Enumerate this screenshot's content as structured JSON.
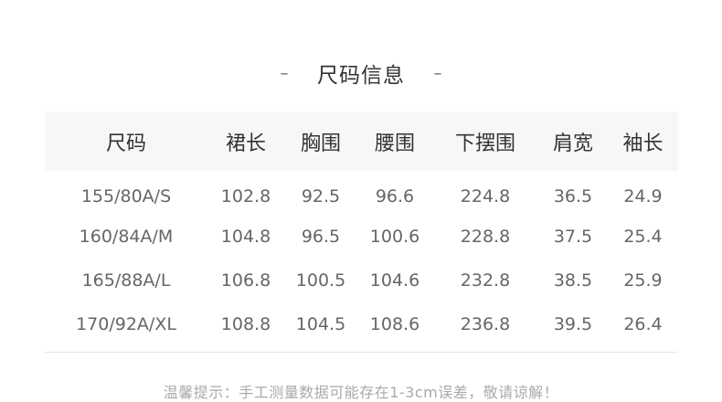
{
  "title": {
    "left_dash": "–",
    "text": "尺码信息",
    "right_dash": "–"
  },
  "table": {
    "headers": [
      "尺码",
      "裙长",
      "胸围",
      "腰围",
      "下摆围",
      "肩宽",
      "袖长"
    ],
    "rows": [
      [
        "155/80A/S",
        "102.8",
        "92.5",
        "96.6",
        "224.8",
        "36.5",
        "24.9"
      ],
      [
        "160/84A/M",
        "104.8",
        "96.5",
        "100.6",
        "228.8",
        "37.5",
        "25.4"
      ],
      [
        "165/88A/L",
        "106.8",
        "100.5",
        "104.6",
        "232.8",
        "38.5",
        "25.9"
      ],
      [
        "170/92A/XL",
        "108.8",
        "104.5",
        "108.6",
        "236.8",
        "39.5",
        "26.4"
      ]
    ]
  },
  "footnote": "温馨提示：手工测量数据可能存在1-3cm误差，敬请谅解！",
  "colors": {
    "header_background": "#f7f7f7",
    "header_text": "#333333",
    "cell_text": "#666666",
    "footnote_text": "#aaaaaa"
  }
}
